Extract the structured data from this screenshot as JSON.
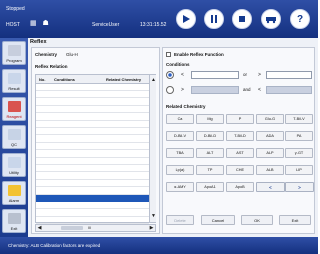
{
  "header": {
    "status": "Stopped",
    "host": "HOST",
    "user": "ServiceUser",
    "clock": "13:31:15.52",
    "buttons": [
      {
        "name": "start",
        "icon": "play-icon"
      },
      {
        "name": "pause",
        "icon": "pause-icon"
      },
      {
        "name": "stop",
        "icon": "stop-icon"
      },
      {
        "name": "ambulance",
        "icon": "ambulance-icon"
      },
      {
        "name": "help",
        "icon": "help-icon",
        "label": "?"
      }
    ]
  },
  "sidebar": {
    "items": [
      {
        "label": "Program",
        "icon": "program-icon",
        "color": "#c7cedd"
      },
      {
        "label": "Result",
        "icon": "result-icon",
        "color": "#c9d6ea"
      },
      {
        "label": "Reagent",
        "icon": "reagent-icon",
        "color": "#d9534f"
      },
      {
        "label": "QC",
        "icon": "qc-icon",
        "color": "#c7d3e6"
      },
      {
        "label": "Utility",
        "icon": "utility-icon",
        "color": "#c9d6ea"
      },
      {
        "label": "Alarm",
        "icon": "alarm-icon",
        "color": "#f2c233"
      },
      {
        "label": "Exit",
        "icon": "exit-icon",
        "color": "#b8c0cf"
      }
    ]
  },
  "main": {
    "title": "Reflex",
    "chemistry_label": "Chemistry",
    "chemistry_value": "Glu-H",
    "reflex_relation_label": "Reflex Relation",
    "table": {
      "columns": [
        "No.",
        "Conditions",
        "Related Chemistry"
      ],
      "row_count": 19,
      "selected_row": 15,
      "hscroll_mark": "III"
    },
    "enable_label": "Enable Reflex Function",
    "conditions_label": "Conditions",
    "or_label": "or",
    "and_label": "and",
    "related_label": "Related Chemistry",
    "chem_buttons": [
      [
        "Ca",
        "Mg",
        "P",
        "Glu-G",
        "T-Bil-V"
      ],
      [
        "D-Bil-V",
        "D-Bil-D",
        "T-Bil-D",
        "ADA",
        "PA"
      ],
      [
        "TBA",
        "ALT",
        "AST",
        "ALP",
        "γ-GT"
      ],
      [
        "Lp(a)",
        "TP",
        "CHE",
        "ALB",
        "LIP"
      ],
      [
        "α-AMY",
        "ApoA1",
        "ApoB"
      ]
    ],
    "page_buttons": [
      "<",
      ">"
    ],
    "actions": {
      "delete": "Delete",
      "cancel": "Cancel",
      "ok": "OK",
      "exit": "Exit"
    }
  },
  "status_bar": {
    "message": "Chemistry: ALB  Calibration factors are expired"
  },
  "colors": {
    "header_blue": "#1f3f95",
    "selected_row": "#1e57b8",
    "accent_blue": "#2b5fc6"
  }
}
